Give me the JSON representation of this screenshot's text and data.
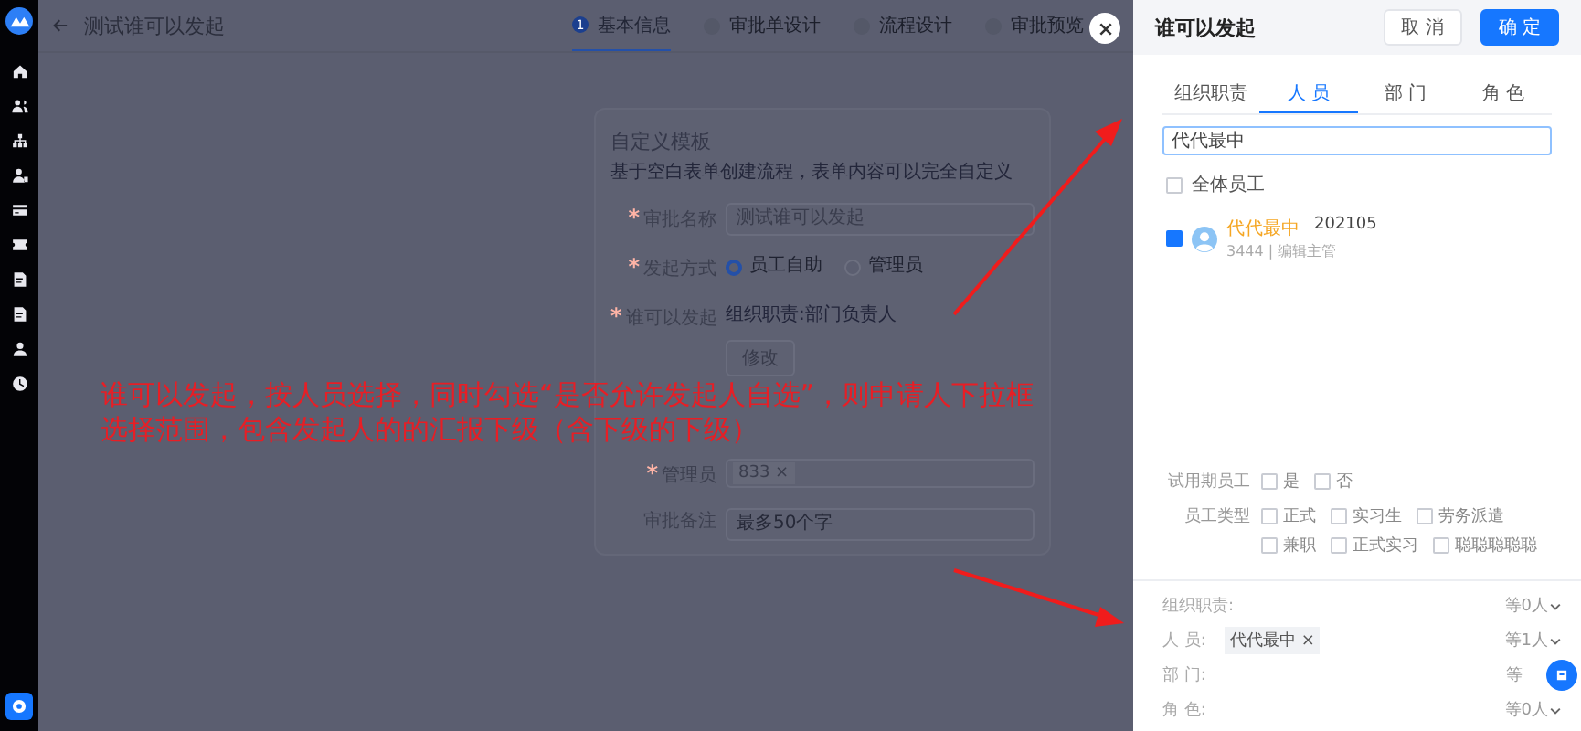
{
  "header": {
    "title": "测试谁可以发起",
    "steps": [
      {
        "number": "1",
        "label": "基本信息",
        "selected": true
      },
      {
        "label": "审批单设计",
        "selected": false
      },
      {
        "label": "流程设计",
        "selected": false
      },
      {
        "label": "审批预览",
        "selected": false
      }
    ]
  },
  "form": {
    "title": "自定义模板",
    "subtitle": "基于空白表单创建流程，表单内容可以完全自定义",
    "fields": [
      {
        "kind": "textarea",
        "label": "审批名称",
        "mark": "*",
        "value": "测试谁可以发起"
      },
      {
        "kind": "radio",
        "label": "发起方式",
        "mark": "*",
        "options": [
          {
            "label": "员工自助",
            "selected": true
          },
          {
            "label": "管理员",
            "selected": false
          }
        ]
      },
      {
        "kind": "picker",
        "label": "谁可以发起",
        "mark": "*",
        "value": "组织职责:部门负责人",
        "button": "修改"
      },
      {
        "kind": "hidden"
      },
      {
        "kind": "tags",
        "label": "管理员",
        "mark": "*",
        "tags": [
          "833 ×"
        ]
      },
      {
        "kind": "textarea",
        "label": "审批备注",
        "placeholder": "最多50个字"
      }
    ]
  },
  "annotation": {
    "lines": [
      "谁可以发起，按人员选择，同时勾选“是否允许发起人自选”，则申请人下拉框",
      "选择范围，包含发起人的的汇报下级（含下级的下级）"
    ]
  },
  "dialog": {
    "title": "谁可以发起",
    "buttons": [
      {
        "label": "取 消",
        "kind": "secondary"
      },
      {
        "label": "确 定",
        "kind": "primary"
      }
    ],
    "tabs": [
      {
        "label": "组织职责",
        "selected": false
      },
      {
        "label": "人 员",
        "selected": true
      },
      {
        "label": "部 门",
        "selected": false
      },
      {
        "label": "角 色",
        "selected": false
      }
    ],
    "search": {
      "value": "代代最中"
    },
    "all_employees": {
      "label": "全体员工",
      "checked": false
    },
    "people": [
      {
        "name": "代代最中",
        "code": "202105",
        "detail": "3444 | 编辑主管",
        "checked": true
      }
    ],
    "filters": [
      {
        "label": "试用期员工",
        "options": [
          {
            "label": "是",
            "checked": false
          },
          {
            "label": "否",
            "checked": false
          }
        ]
      },
      {
        "label": "员工类型",
        "options": [
          {
            "label": "正式",
            "checked": false
          },
          {
            "label": "实习生",
            "checked": false
          },
          {
            "label": "劳务派遣",
            "checked": false
          },
          {
            "label": "兼职",
            "checked": false
          },
          {
            "label": "正式实习",
            "checked": false
          },
          {
            "label": "聪聪聪聪聪",
            "checked": false
          }
        ]
      }
    ],
    "summary": [
      {
        "label": "组织职责:",
        "count": "等0人"
      },
      {
        "label": "人 员:",
        "tags": [
          "代代最中 ×"
        ],
        "count": "等1人"
      },
      {
        "label": "部 门:",
        "count": "等"
      },
      {
        "label": "角 色:",
        "count": "等0人"
      }
    ]
  }
}
